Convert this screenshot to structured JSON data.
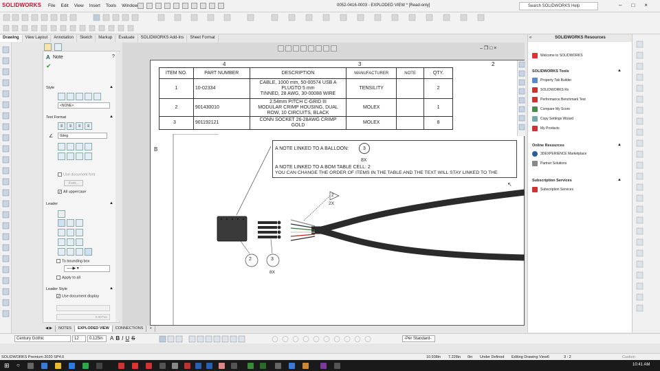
{
  "app": {
    "brand": "SOLIDWORKS",
    "title": "0052-0416-0003 - EXPLODED VIEW * [Read-only]",
    "menu": [
      "File",
      "Edit",
      "View",
      "Insert",
      "Tools",
      "Window"
    ],
    "search_placeholder": "Search SOLIDWORKS Help"
  },
  "tabs": [
    "Drawing",
    "View Layout",
    "Annotation",
    "Sketch",
    "Markup",
    "Evaluate",
    "SOLIDWORKS Add-Ins",
    "Sheet Format"
  ],
  "property_manager": {
    "title": "Note",
    "sections": {
      "style": "Style",
      "text_format": "Text Format",
      "leader": "Leader",
      "leader_style": "Leader Style"
    },
    "style_select": "<NONE>",
    "angle": "0deg",
    "use_doc_font": "Use document font",
    "font_button": "Font...",
    "all_uppercase": "All uppercase",
    "to_bounding_box": "To bounding box",
    "apply_to_all": "Apply to all",
    "use_doc_display": "Use document display",
    "line_thickness": "0.0071in"
  },
  "drawing": {
    "zone_numbers": [
      "4",
      "3",
      "2"
    ],
    "zone_letter": "B",
    "bom": {
      "headers": [
        "ITEM NO.",
        "PART NUMBER",
        "DESCRIPTION",
        "MANUFACTURER",
        "NOTE",
        "QTY."
      ],
      "rows": [
        {
          "item": "1",
          "part": "10-02334",
          "desc": [
            "CABLE, 1000 mm, 50-00574 USB A",
            "PLUGTO 5 mm",
            "TINNED, 28 AWG, 30-00088 WIRE"
          ],
          "mfr": "TENSILITY",
          "note": "",
          "qty": "2"
        },
        {
          "item": "2",
          "part": "901430010",
          "desc": [
            "2.54mm PITCH C-GRID III",
            "MODULAR CRIMP HOUSING, DUAL",
            "ROW, 10 CIRCUITS, BLACK"
          ],
          "mfr": "MOLEX",
          "note": "",
          "qty": "1"
        },
        {
          "item": "3",
          "part": "901192121",
          "desc": [
            "CONN SOCKET 26-28AWG CRIMP",
            "GOLD"
          ],
          "mfr": "MOLEX",
          "note": "",
          "qty": "8"
        }
      ]
    },
    "note_lines": {
      "line1": "A NOTE LINKED TO A BALLOON:",
      "balloon": "3",
      "line2": "8X",
      "line3": "A NOTE LINKED TO A BOM TABLE CELL: 2",
      "line4": "YOU CAN CHANGE THE ORDER OF ITEMS IN THE TABLE AND THE TEXT WILL STAY LINKED TO THE"
    },
    "balloon_2": "2",
    "balloon_3": "3",
    "qty_8x": "8X",
    "flag_label": "2",
    "qty_2x": "2X"
  },
  "resources": {
    "title": "SOLIDWORKS Resources",
    "welcome": "Welcome to SOLIDWORKS",
    "tools_header": "SOLIDWORKS Tools",
    "tools": [
      "Property Tab Builder",
      "SOLIDWORKS Rx",
      "Performance Benchmark Test",
      "Compare My Score",
      "Copy Settings Wizard",
      "My Products"
    ],
    "online_header": "Online Resources",
    "online": [
      "3DEXPERIENCE Marketplace",
      "Partner Solutions"
    ],
    "subs_header": "Subscription Services",
    "subs": [
      "Subscription Services"
    ]
  },
  "sheet_tabs": [
    "NOTES",
    "EXPLODED VIEW",
    "CONNECTIONS"
  ],
  "format_bar": {
    "font": "Century Gothic",
    "size": "12",
    "height": "0.125in",
    "layer": "-Per Standard-"
  },
  "status": {
    "product": "SOLIDWORKS Premium 2020 SP4.0",
    "x": "10.938in",
    "y": "7.228in",
    "z": "0in",
    "state": "Under Defined",
    "editing": "Editing Drawing View6",
    "scale": "3 : 2",
    "units": "Custom"
  },
  "taskbar": {
    "time": "10:41 AM"
  },
  "colors": {
    "brand_red": "#c8102e",
    "cable": "#2b2b2b",
    "taskbar": "#1a1a1a"
  }
}
